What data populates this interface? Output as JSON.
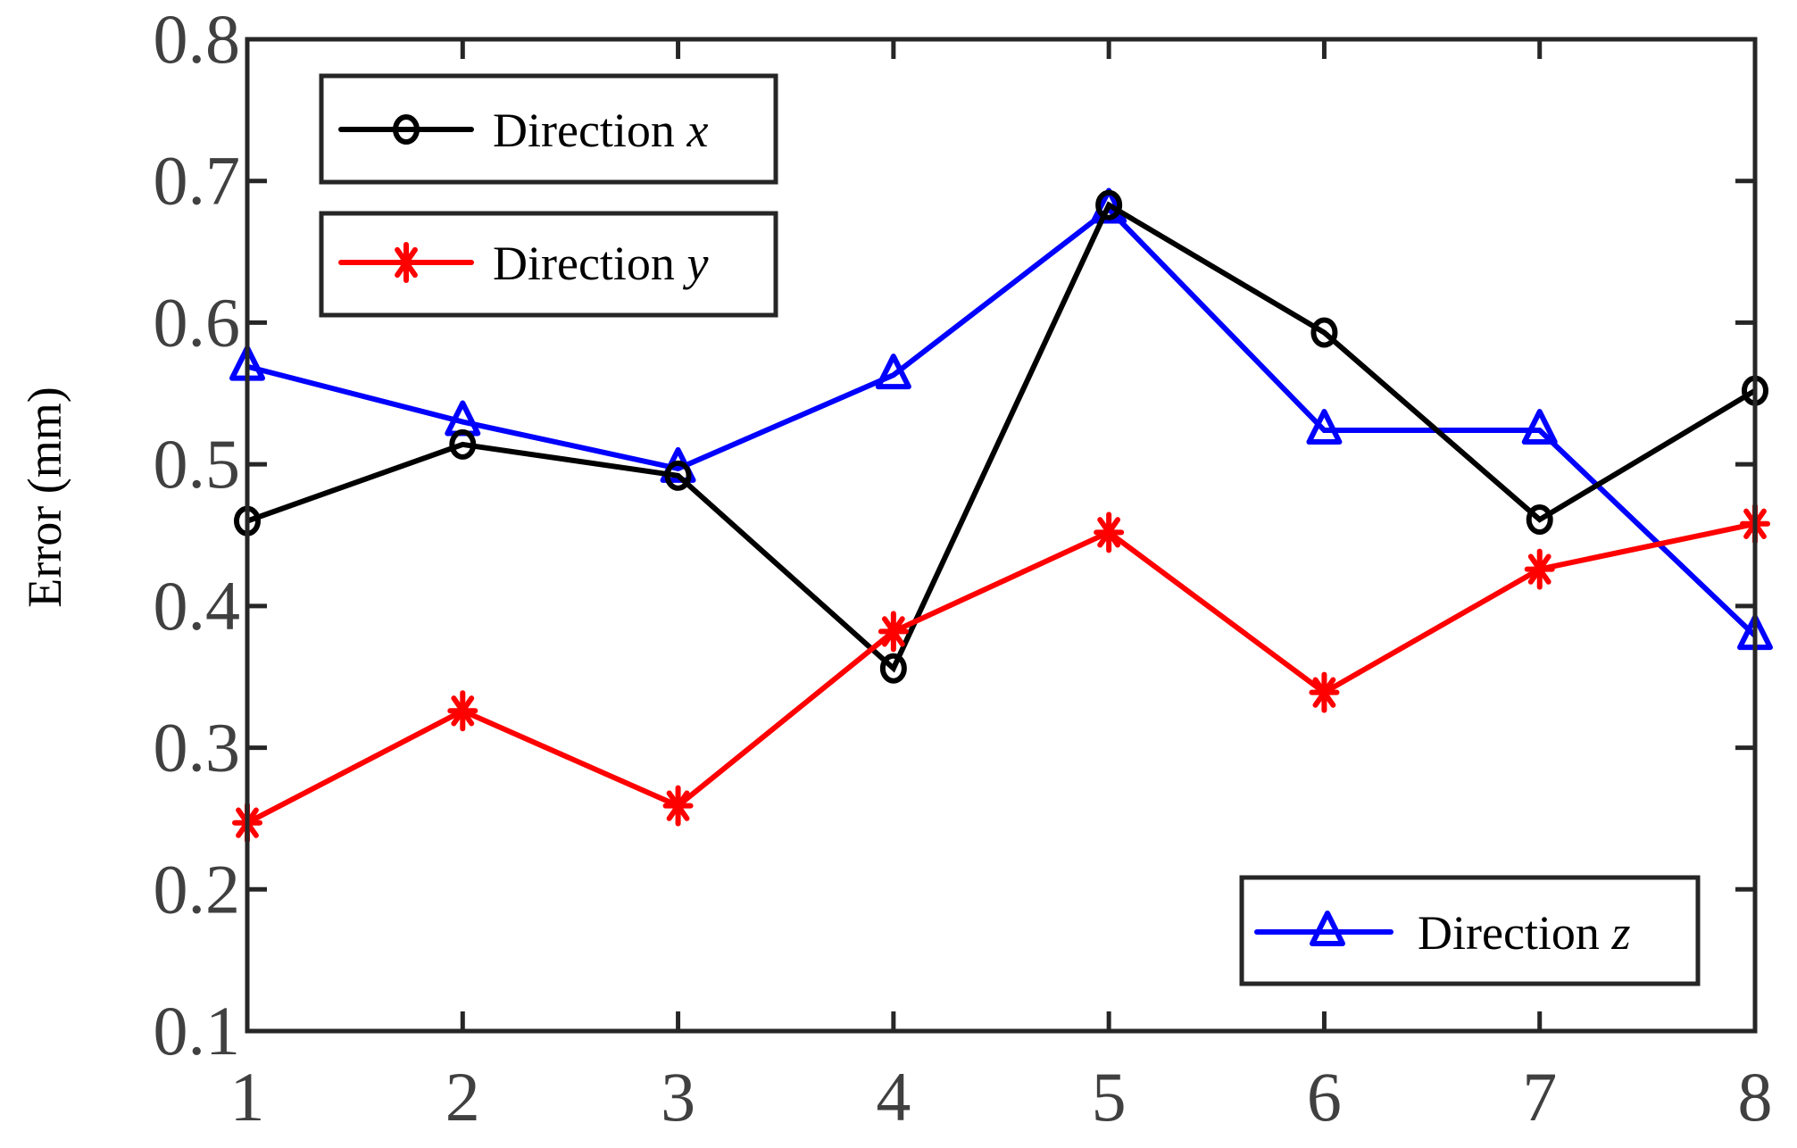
{
  "chart_data": {
    "type": "line",
    "title": "",
    "xlabel": "",
    "ylabel": "Error (mm)",
    "x": [
      1,
      2,
      3,
      4,
      5,
      6,
      7,
      8
    ],
    "xlim": [
      1,
      8
    ],
    "ylim": [
      0.1,
      0.8
    ],
    "xticks": [
      "1",
      "2",
      "3",
      "4",
      "5",
      "6",
      "7",
      "8"
    ],
    "yticks": [
      "0.1",
      "0.2",
      "0.3",
      "0.4",
      "0.5",
      "0.6",
      "0.7",
      "0.8"
    ],
    "grid": false,
    "series": [
      {
        "name": "Direction x",
        "label_main": "Direction ",
        "label_var": "x",
        "color": "#000000",
        "marker": "circle",
        "values": [
          0.46,
          0.514,
          0.492,
          0.356,
          0.683,
          0.593,
          0.461,
          0.552
        ],
        "legend": "top-left"
      },
      {
        "name": "Direction y",
        "label_main": "Direction ",
        "label_var": "y",
        "color": "#ff0000",
        "marker": "asterisk",
        "values": [
          0.247,
          0.326,
          0.259,
          0.382,
          0.452,
          0.339,
          0.426,
          0.458
        ],
        "legend": "top-left"
      },
      {
        "name": "Direction z",
        "label_main": "Direction ",
        "label_var": "z",
        "color": "#0000ff",
        "marker": "triangle",
        "values": [
          0.569,
          0.53,
          0.497,
          0.563,
          0.68,
          0.524,
          0.524,
          0.379
        ],
        "legend": "bottom-right"
      }
    ]
  }
}
